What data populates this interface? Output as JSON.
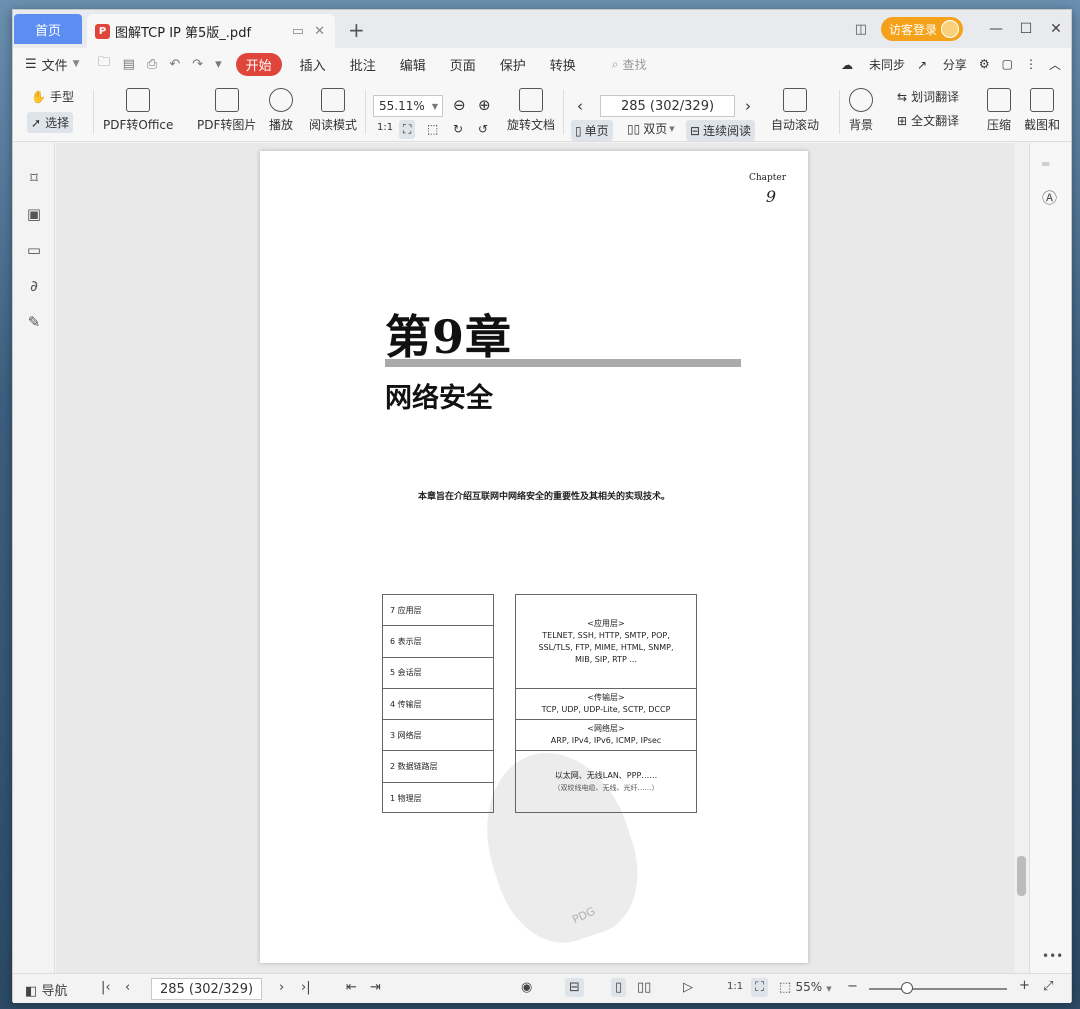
{
  "tabs": {
    "home": "首页",
    "doc_title": "图解TCP IP 第5版_.pdf",
    "login": "访客登录"
  },
  "menu": {
    "file": "文件",
    "start": "开始",
    "items": [
      "插入",
      "批注",
      "编辑",
      "页面",
      "保护",
      "转换"
    ],
    "search_placeholder": "查找",
    "unsync": "未同步",
    "share": "分享"
  },
  "ribbon": {
    "hand": "手型",
    "select": "选择",
    "pdf_to_office": "PDF转Office",
    "pdf_to_image": "PDF转图片",
    "play": "播放",
    "read_mode": "阅读模式",
    "zoom": "55.11%",
    "rotate_doc": "旋转文档",
    "page_indicator": "285 (302/329)",
    "single": "单页",
    "double": "双页",
    "continuous": "连续阅读",
    "auto_scroll": "自动滚动",
    "background": "背景",
    "word_translate": "划词翻译",
    "full_translate": "全文翻译",
    "compress": "压缩",
    "screenshot": "截图和"
  },
  "page_content": {
    "chapter_label": "Chapter",
    "chapter_number": "9",
    "title": "第9章",
    "subtitle": "网络安全",
    "description": "本章旨在介绍互联网中网络安全的重要性及其相关的实现技术。",
    "osi_layers": [
      "7 应用层",
      "6 表示层",
      "5 会话层",
      "4 传输层",
      "3 网络层",
      "2 数据链路层",
      "1 物理层"
    ],
    "app_layer_header": "<应用层>",
    "app_layer_protocols": "TELNET, SSH, HTTP, SMTP, POP, SSL/TLS, FTP, MIME, HTML, SNMP, MIB, SIP, RTP ...",
    "transport_header": "<传输层>",
    "transport_protocols": "TCP, UDP, UDP-Lite, SCTP, DCCP",
    "network_header": "<网络层>",
    "network_protocols": "ARP, IPv4, IPv6, ICMP, IPsec",
    "link_protocols": "以太网、无线LAN、PPP……",
    "physical_note": "（双绞线电缆、无线、光纤……）",
    "watermark": "PDG"
  },
  "statusbar": {
    "nav": "导航",
    "page": "285 (302/329)",
    "zoom": "55%"
  }
}
